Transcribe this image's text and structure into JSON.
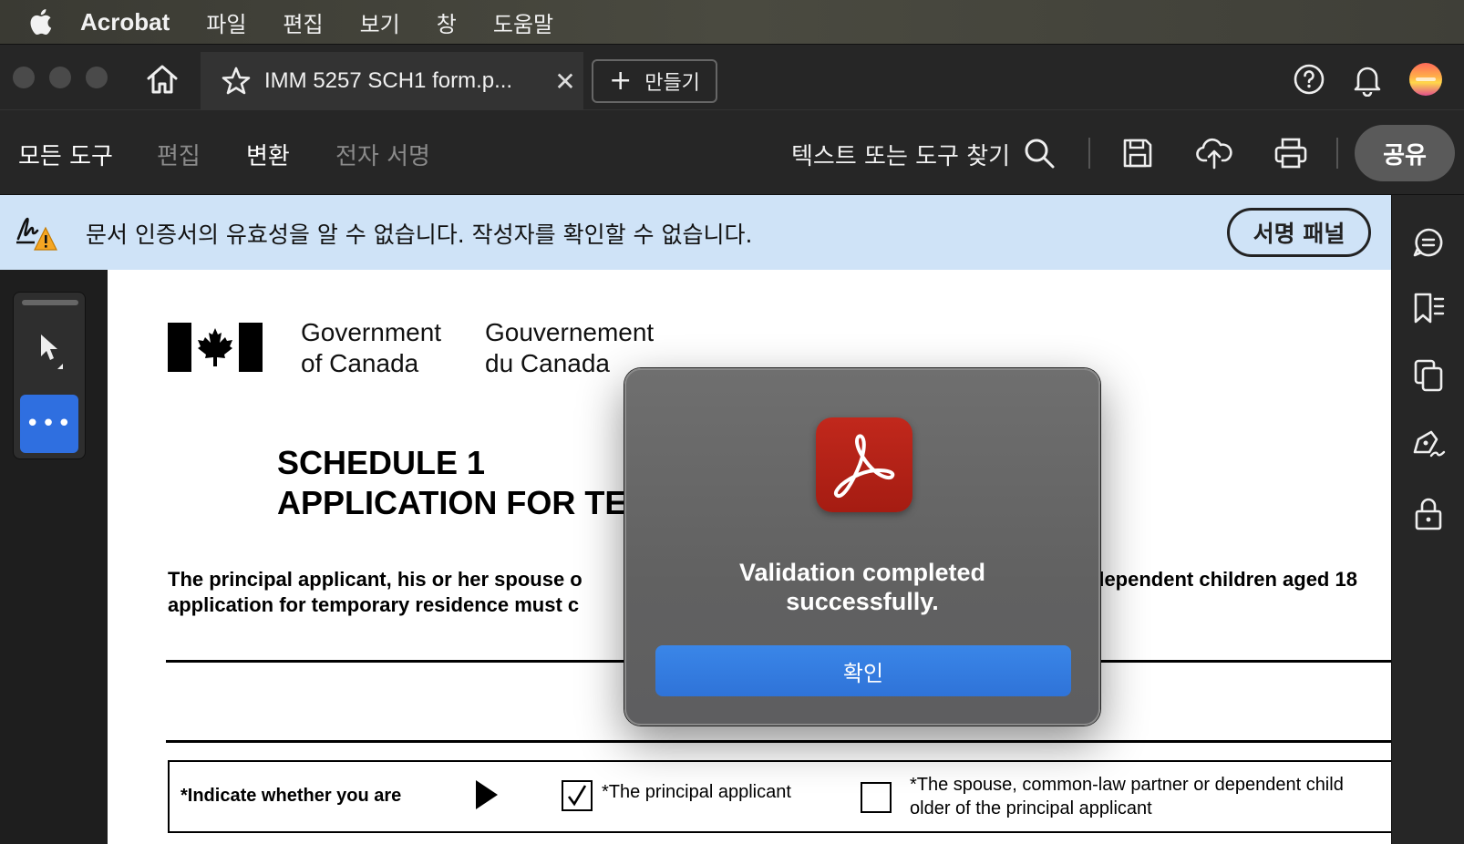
{
  "menubar": {
    "app_name": "Acrobat",
    "items": [
      "파일",
      "편집",
      "보기",
      "창",
      "도움말"
    ]
  },
  "tabbar": {
    "tab_title": "IMM 5257 SCH1 form.p...",
    "create_label": "만들기"
  },
  "toolbar": {
    "tabs": [
      {
        "label": "모든 도구",
        "active": true
      },
      {
        "label": "편집",
        "active": false
      },
      {
        "label": "변환",
        "active": true
      },
      {
        "label": "전자 서명",
        "active": false
      }
    ],
    "search_label": "텍스트 또는 도구 찾기",
    "share_label": "공유"
  },
  "banner": {
    "message": "문서 인증서의 유효성을 알 수 없습니다. 작성자를 확인할 수 없습니다.",
    "panel_button": "서명 패널",
    "background": "#cfe3f7"
  },
  "document": {
    "gov_en": [
      "Government",
      "of Canada"
    ],
    "gov_fr": [
      "Gouvernement",
      "du Canada"
    ],
    "schedule_title": "SCHEDULE 1\nAPPLICATION FOR TE",
    "intro_left": [
      "The principal applicant, his or her spouse o",
      "application for temporary residence must c"
    ],
    "intro_right": "dependent children aged 18",
    "indicate_label": "*Indicate whether you are",
    "option1_label": "*The principal applicant",
    "option1_checked": true,
    "option2_label": [
      "*The spouse, common-law partner or dependent child",
      "older of the principal applicant"
    ],
    "option2_checked": false
  },
  "dialog": {
    "message": "Validation completed\nsuccessfully.",
    "ok_label": "확인",
    "accent": "#2f73d8"
  }
}
